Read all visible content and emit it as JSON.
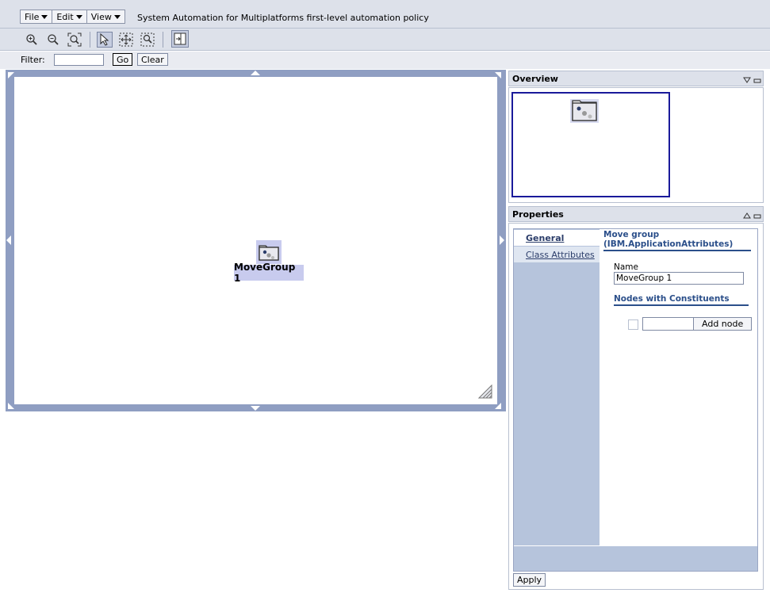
{
  "menubar": {
    "file": "File",
    "edit": "Edit",
    "view": "View",
    "app_title": "System Automation for Multiplatforms first-level automation policy"
  },
  "toolbar": {
    "icons": [
      "zoom-in-icon",
      "zoom-out-icon",
      "zoom-fit-icon",
      "select-icon",
      "pan-icon",
      "zoom-area-icon",
      "toggle-panel-icon"
    ]
  },
  "filter": {
    "label": "Filter:",
    "value": "",
    "go_label": "Go",
    "clear_label": "Clear"
  },
  "canvas": {
    "node_label": "MoveGroup 1"
  },
  "overview": {
    "title": "Overview"
  },
  "properties": {
    "title": "Properties",
    "tabs": [
      {
        "label": "General"
      },
      {
        "label": "Class Attributes"
      }
    ],
    "group_title_line1": "Move group",
    "group_title_line2": "(IBM.ApplicationAttributes)",
    "name_label": "Name",
    "name_value": "MoveGroup 1",
    "nodes_title": "Nodes with Constituents",
    "add_node_label": "Add node",
    "apply_label": "Apply"
  },
  "colors": {
    "frame": "#8f9ec2",
    "selection": "#c8cbee",
    "accent_text": "#2b4f8a",
    "viewport": "#1a1a9a"
  }
}
